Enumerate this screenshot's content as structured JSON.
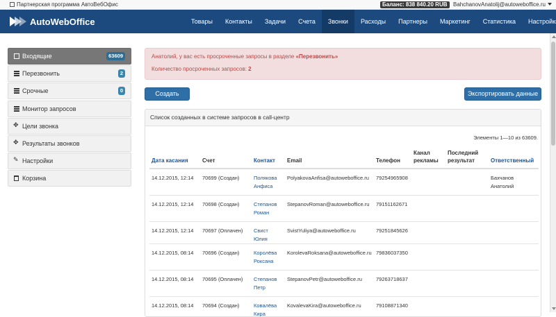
{
  "topbar": {
    "partner_label": "Партнерская программа АвтоВебОфис",
    "balance": "Баланс: 838 840.20 RUB",
    "user": "BahchanovAnatolij@autoweboffice.ru"
  },
  "brand": {
    "name": "AutoWebOffice"
  },
  "nav": {
    "items": [
      "Товары",
      "Контакты",
      "Задачи",
      "Счета",
      "Звонки",
      "Расходы",
      "Партнеры",
      "Маркетинг",
      "Статистика",
      "Настройки"
    ],
    "active": "Звонки"
  },
  "sidebar": {
    "items": [
      {
        "label": "Входящие",
        "icon": "inbox-icon",
        "badge": "63609"
      },
      {
        "label": "Перезвонить",
        "icon": "list-icon",
        "badge": "2"
      },
      {
        "label": "Срочные",
        "icon": "list-icon",
        "badge": "0"
      },
      {
        "label": "Монитор запросов",
        "icon": "list-icon"
      },
      {
        "label": "Цели звонка",
        "icon": "move-icon"
      },
      {
        "label": "Результаты звонков",
        "icon": "move-icon"
      },
      {
        "label": "Настройки",
        "icon": "wrench-icon"
      },
      {
        "label": "Корзина",
        "icon": "trash-icon"
      }
    ]
  },
  "alert": {
    "line1_prefix": "Анатолий, у вас есть просроченные запросы в разделе ",
    "line1_link": "«Перезвонить»",
    "line2_prefix": "Количество просроченных запросов: ",
    "line2_value": "2"
  },
  "buttons": {
    "create": "Создать",
    "export": "Экспортировать данные"
  },
  "panel": {
    "title": "Список созданных в системе запросов в call-центр",
    "count": "Элементы 1—10 из 63609."
  },
  "table": {
    "headers": [
      "Дата касания",
      "Счет",
      "Контакт",
      "Email",
      "Телефон",
      "Канал рекламы",
      "Последний результат",
      "Ответственный"
    ],
    "rows": [
      {
        "date": "14.12.2015, 12:14",
        "invoice": "70699 (Создан)",
        "contact": "Полякова Анфиса",
        "email": "PolyakovaAnfisa@autoweboffice.ru",
        "phone": "79254965908",
        "channel": "",
        "result": "",
        "owner": "Бахчанов Анатолий"
      },
      {
        "date": "14.12.2015, 12:14",
        "invoice": "70698 (Создан)",
        "contact": "Степанов Роман",
        "email": "StepanovRoman@autoweboffice.ru",
        "phone": "79151162671",
        "channel": "",
        "result": "",
        "owner": ""
      },
      {
        "date": "14.12.2015, 12:14",
        "invoice": "70697 (Оплачен)",
        "contact": "Свист Юлия",
        "email": "SvistYuliya@autoweboffice.ru",
        "phone": "79251845626",
        "channel": "",
        "result": "",
        "owner": ""
      },
      {
        "date": "14.12.2015, 08:14",
        "invoice": "70696 (Создан)",
        "contact": "Королёва Роксана",
        "email": "KorolevaRoksana@autoweboffice.ru",
        "phone": "79836037350",
        "channel": "",
        "result": "",
        "owner": ""
      },
      {
        "date": "14.12.2015, 08:14",
        "invoice": "70695 (Оплачен)",
        "contact": "Степанов Петр",
        "email": "StepanovPetr@autoweboffice.ru",
        "phone": "79263718637",
        "channel": "",
        "result": "",
        "owner": ""
      },
      {
        "date": "14.12.2015, 08:14",
        "invoice": "70694 (Создан)",
        "contact": "Ковалёва Кира",
        "email": "KovalevaKira@autoweboffice.ru",
        "phone": "79108871340",
        "channel": "",
        "result": "",
        "owner": ""
      }
    ]
  }
}
